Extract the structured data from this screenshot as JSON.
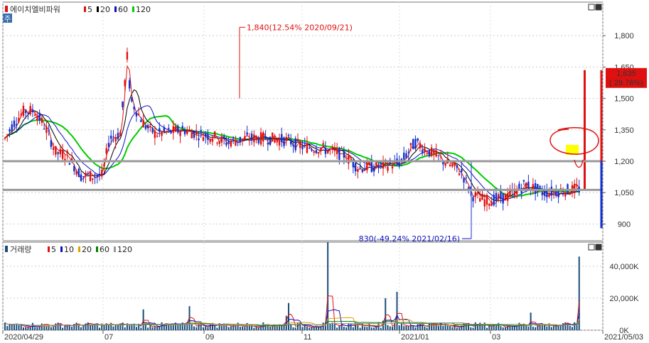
{
  "title": "에이치엘비파워",
  "colors": {
    "up": "#e01010",
    "down": "#1030d0",
    "ma5": "#e01010",
    "ma20": "#000000",
    "ma60": "#1010c0",
    "ma120": "#00cc00",
    "vol": "#1a4d7a",
    "highlight": "#ffff00",
    "guide": "#999999"
  },
  "price_legend": [
    {
      "label": "5",
      "color": "#e01010"
    },
    {
      "label": "20",
      "color": "#000000"
    },
    {
      "label": "60",
      "color": "#1010c0"
    },
    {
      "label": "120",
      "color": "#00cc00"
    }
  ],
  "volume_title": "거래량",
  "volume_legend": [
    {
      "label": "5",
      "color": "#e01010"
    },
    {
      "label": "10",
      "color": "#1010c0"
    },
    {
      "label": "20",
      "color": "#e0a000"
    },
    {
      "label": "60",
      "color": "#008000"
    },
    {
      "label": "120",
      "color": "#999999"
    }
  ],
  "side_mark": "주",
  "window_buttons": [
    "▫",
    "▪"
  ],
  "chart_data": [
    {
      "type": "candlestick",
      "panel": "price",
      "y_ticks": [
        "1,800",
        "1,650",
        "1,500",
        "1,350",
        "1,200",
        "1,050",
        "900"
      ],
      "y_tick_values": [
        1800,
        1650,
        1500,
        1350,
        1200,
        1050,
        900
      ],
      "ylim": [
        820,
        1960
      ],
      "annotations": [
        {
          "text": "1,840(12.54% 2020/09/21)",
          "value": 1840,
          "color": "#e01010"
        },
        {
          "text": "830(-49.24% 2021/02/16)",
          "value": 830,
          "color": "#1010c0"
        }
      ],
      "last_price": {
        "value": 1635,
        "price_text": "1,635",
        "change_text": "( 29.76%)",
        "color": "#e01010"
      },
      "horizontal_levels": [
        1200,
        1063
      ],
      "ma120_level_area": true
    },
    {
      "type": "bar",
      "panel": "volume",
      "y_ticks": [
        "40,000K",
        "20,000K",
        "0K"
      ],
      "y_tick_values": [
        40000,
        20000,
        0
      ],
      "ylim": [
        0,
        55000
      ],
      "unit": "K"
    }
  ],
  "x_labels": [
    "2020/04/29",
    "07",
    "09",
    "11",
    "2021/01",
    "03",
    "2021/05/03"
  ]
}
